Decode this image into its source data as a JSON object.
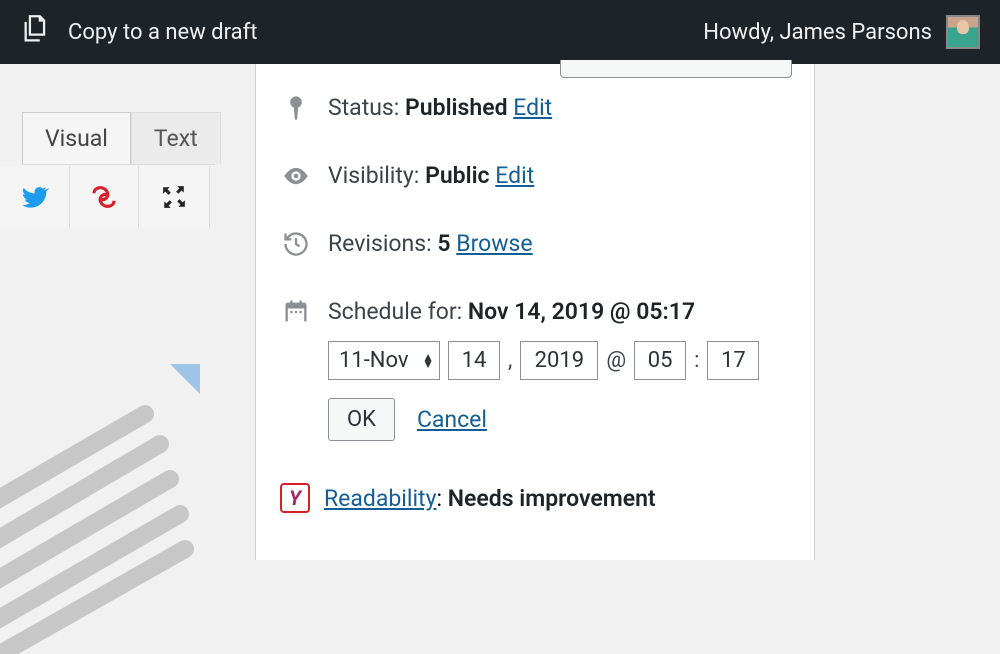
{
  "adminBar": {
    "copyLabel": "Copy to a new draft",
    "greeting": "Howdy, James Parsons"
  },
  "editorTabs": {
    "visual": "Visual",
    "text": "Text"
  },
  "publish": {
    "status": {
      "label": "Status: ",
      "value": "Published",
      "editLabel": "Edit"
    },
    "visibility": {
      "label": "Visibility: ",
      "value": "Public",
      "editLabel": "Edit"
    },
    "revisions": {
      "label": "Revisions: ",
      "count": "5",
      "browseLabel": "Browse"
    },
    "schedule": {
      "label": "Schedule for: ",
      "display": "Nov 14, 2019 @ 05:17",
      "month": "11-Nov",
      "day": "14",
      "year": "2019",
      "hour": "05",
      "minute": "17",
      "commaSep": ",",
      "atSep": "@",
      "colonSep": ":",
      "okLabel": "OK",
      "cancelLabel": "Cancel"
    }
  },
  "yoast": {
    "readabilityLabel": "Readability",
    "colon": ": ",
    "readabilityValue": "Needs improvement"
  }
}
